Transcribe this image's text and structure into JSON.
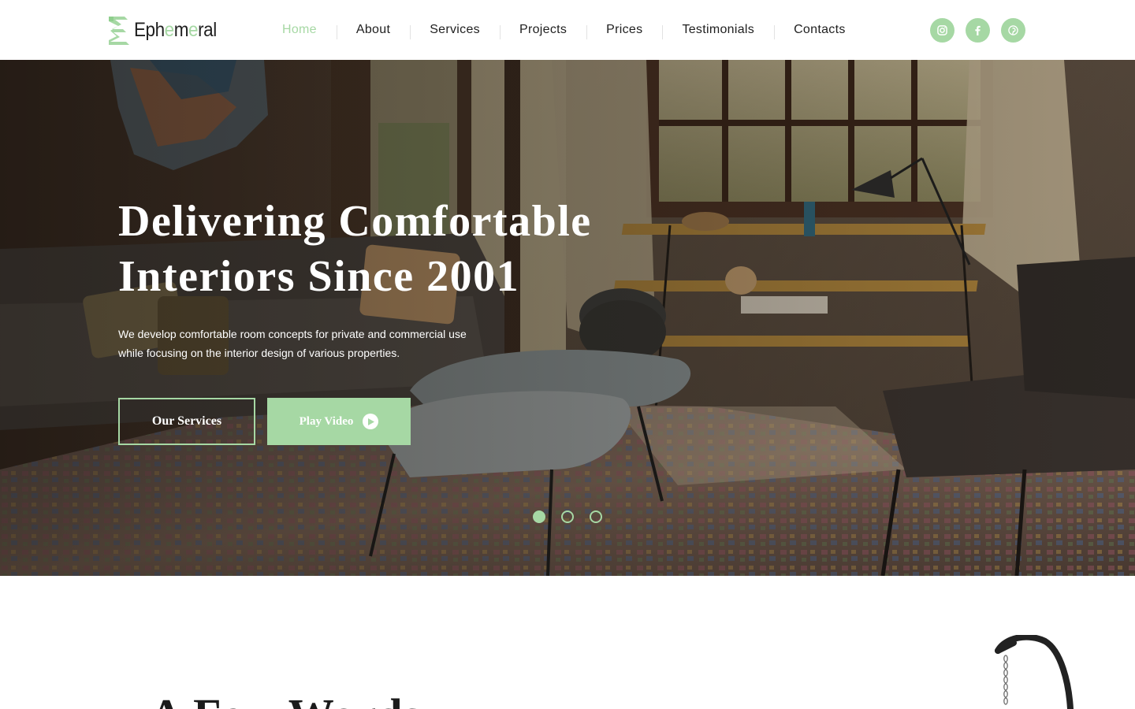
{
  "header": {
    "logo": {
      "text_start": "Eph",
      "text_accent_1": "e",
      "text_mid": "m",
      "text_accent_2": "e",
      "text_end": "ral"
    },
    "nav": [
      {
        "label": "Home",
        "active": true
      },
      {
        "label": "About"
      },
      {
        "label": "Services"
      },
      {
        "label": "Projects"
      },
      {
        "label": "Prices"
      },
      {
        "label": "Testimonials"
      },
      {
        "label": "Contacts"
      }
    ],
    "socials": [
      "instagram-icon",
      "facebook-icon",
      "pinterest-icon"
    ]
  },
  "hero": {
    "title_line_1": "Delivering Comfortable",
    "title_line_2": "Interiors Since 2001",
    "subtitle_line_1": "We develop comfortable room concepts for private and commercial use",
    "subtitle_line_2": "while focusing on the interior design of various properties.",
    "primary_button": "Our Services",
    "secondary_button": "Play Video",
    "slides": {
      "count": 3,
      "active": 1
    }
  },
  "section": {
    "heading": "A Few Words"
  },
  "colors": {
    "accent": "#a6d8a4",
    "text": "#1f1f1f",
    "background": "#ffffff"
  }
}
